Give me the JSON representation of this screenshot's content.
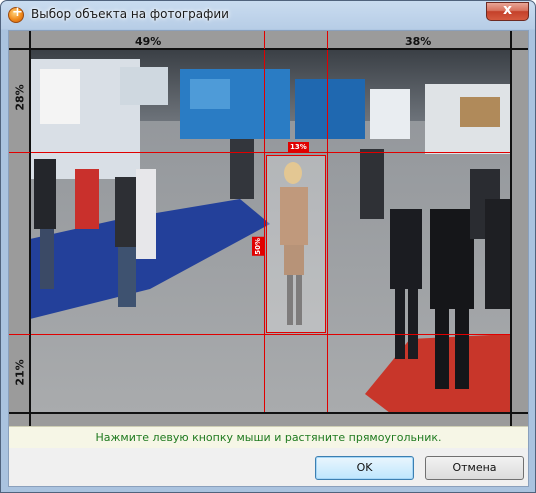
{
  "window": {
    "title": "Выбор объекта на фотографии",
    "close_glyph": "x",
    "icon": "app-plus-icon"
  },
  "ruler": {
    "top_left_pct": "49%",
    "top_right_pct": "38%",
    "left_top_pct": "28%",
    "left_bottom_pct": "21%"
  },
  "selection": {
    "top_badge": "13%",
    "side_badge": "50%"
  },
  "hint": {
    "text": "Нажмите левую кнопку мыши и растяните прямоугольник."
  },
  "buttons": {
    "ok_label": "OK",
    "cancel_label": "Отмена"
  },
  "colors": {
    "grid_lines": "#e00000",
    "hint_text": "#1f7a1f",
    "frame": "#9b9b9b"
  }
}
